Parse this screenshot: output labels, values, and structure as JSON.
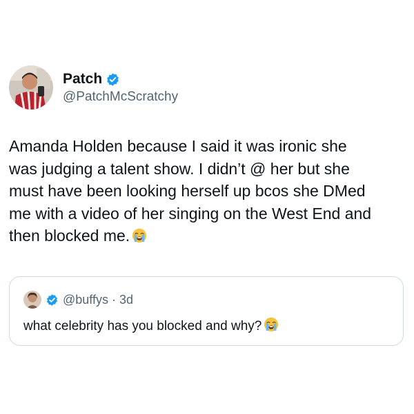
{
  "author": {
    "display_name": "Patch",
    "handle": "@PatchMcScratchy",
    "verified": true,
    "avatar_icon": "user-avatar-icon"
  },
  "tweet": {
    "text": "Amanda Holden because I said it was ironic she\nwas judging a talent show. I didn’t @ her but she\nmust have been looking herself up bcos she DMed\nme with a video of her singing on the West End and\nthen blocked me.",
    "emoji_icon": "loudly-crying-face-icon"
  },
  "quoted_tweet": {
    "handle": "@buffys",
    "separator": "·",
    "time": "3d",
    "verified": true,
    "text": "what celebrity has you blocked and why?",
    "emoji_icon": "loudly-crying-face-icon",
    "avatar_icon": "user-avatar-icon"
  },
  "colors": {
    "text_primary": "#0f1419",
    "text_secondary": "#536471",
    "verified_blue": "#1d9bf0",
    "border": "#cfd9de"
  }
}
